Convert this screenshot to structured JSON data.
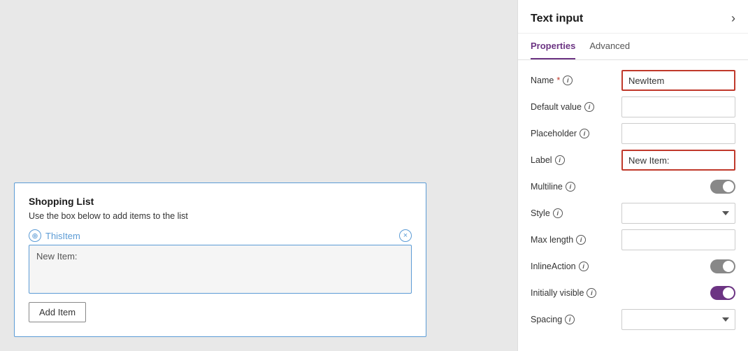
{
  "panel": {
    "title": "Text input",
    "arrow": "›",
    "tabs": [
      {
        "label": "Properties",
        "active": true
      },
      {
        "label": "Advanced",
        "active": false
      }
    ]
  },
  "properties": {
    "name_label": "Name",
    "name_value": "NewItem",
    "default_value_label": "Default value",
    "default_value": "",
    "placeholder_label": "Placeholder",
    "placeholder_value": "",
    "label_label": "Label",
    "label_value": "New Item:",
    "multiline_label": "Multiline",
    "style_label": "Style",
    "max_length_label": "Max length",
    "inline_action_label": "InlineAction",
    "initially_visible_label": "Initially visible",
    "spacing_label": "Spacing"
  },
  "card": {
    "title": "Shopping List",
    "subtitle": "Use the box below to add items to the list",
    "this_item": "ThisItem",
    "text_input_label": "New Item:",
    "add_button": "Add Item"
  },
  "icons": {
    "info": "i",
    "close": "×",
    "move": "⊕",
    "chevron_down": "∨"
  }
}
